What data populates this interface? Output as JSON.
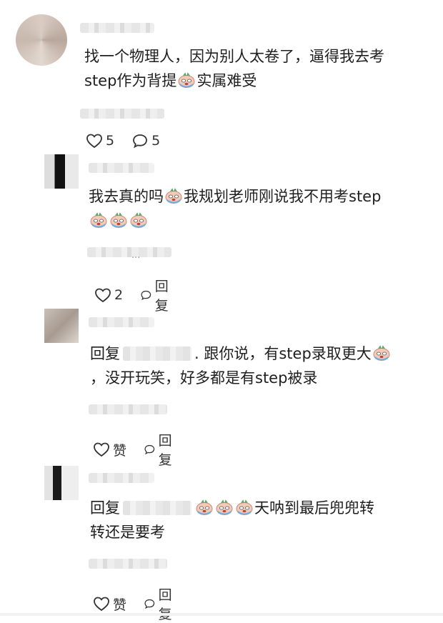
{
  "comments": [
    {
      "text_lines": [
        "找一个物理人，因为别人太卷了，逼得我去考",
        "step作为背提",
        "实属难受"
      ],
      "likes": "5",
      "replies": "5"
    },
    {
      "text_line1_a": "我去真的吗",
      "text_line1_b": "我规划老师刚说我不用考step",
      "likes": "2",
      "reply_label": "回复",
      "ellipsis": "..."
    },
    {
      "prefix": "回复",
      "text_line1": ". 跟你说，有step录取更大",
      "text_line2": "，没开玩笑，好多都是有step被录",
      "like_label": "赞",
      "reply_label": "回复"
    },
    {
      "prefix": "回复",
      "text_line1": "天呐到最后兜兜转",
      "text_line2": "转还是要考",
      "like_label": "赞",
      "reply_label": "回复"
    }
  ],
  "icons": [
    "heart-icon",
    "comment-bubble-icon",
    "crying-emoji-icon"
  ]
}
